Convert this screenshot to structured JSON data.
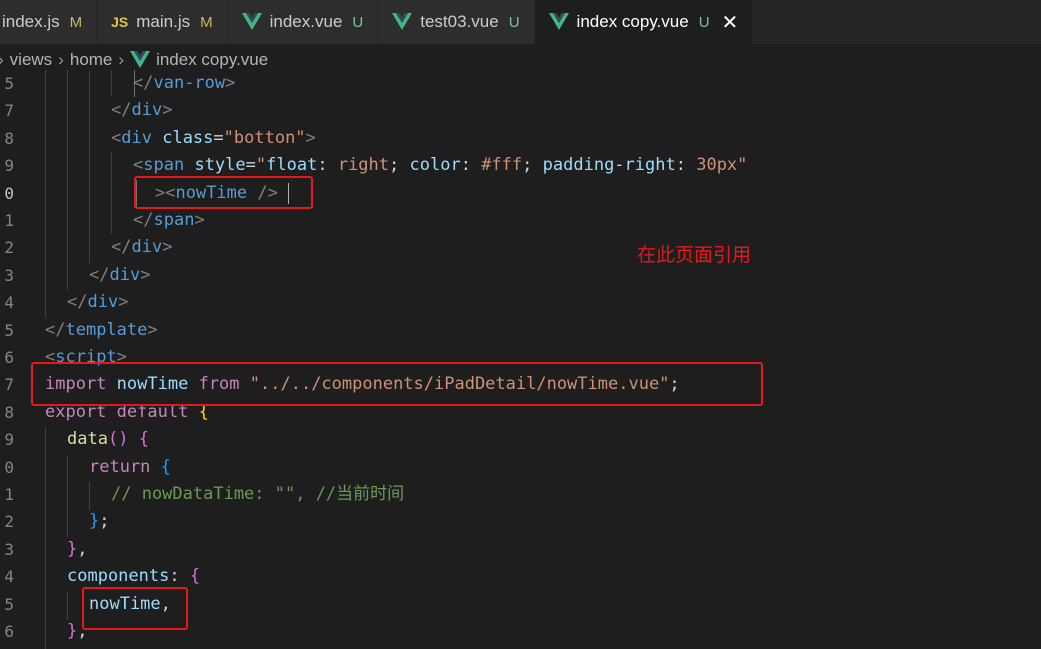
{
  "tabs": [
    {
      "label": "index.js",
      "status": "M",
      "icon": "js"
    },
    {
      "label": "main.js",
      "status": "M",
      "icon": "js",
      "icon_text": "JS"
    },
    {
      "label": "index.vue",
      "status": "U",
      "icon": "vue"
    },
    {
      "label": "test03.vue",
      "status": "U",
      "icon": "vue"
    },
    {
      "label": "index copy.vue",
      "status": "U",
      "icon": "vue",
      "active": true,
      "close": "✕"
    }
  ],
  "breadcrumb": {
    "items": [
      "views",
      "home",
      "index copy.vue"
    ],
    "separator": "›"
  },
  "lines": [
    {
      "num": "5"
    },
    {
      "num": "7"
    },
    {
      "num": "8"
    },
    {
      "num": "9"
    },
    {
      "num": "0"
    },
    {
      "num": "1"
    },
    {
      "num": "2"
    },
    {
      "num": "3"
    },
    {
      "num": "4"
    },
    {
      "num": "5"
    },
    {
      "num": "6"
    },
    {
      "num": "7"
    },
    {
      "num": "8"
    },
    {
      "num": "9"
    },
    {
      "num": "0"
    },
    {
      "num": "1"
    },
    {
      "num": "2"
    },
    {
      "num": "3"
    },
    {
      "num": "4"
    },
    {
      "num": "5"
    },
    {
      "num": "6"
    }
  ],
  "code": {
    "l1": {
      "c": "</",
      "tag": "van-row",
      "e": ">"
    },
    "l2": {
      "c": "</",
      "tag": "div",
      "e": ">"
    },
    "l3": {
      "o": "<",
      "tag": "div",
      "attr": "class",
      "eq": "=",
      "val": "\"botton\"",
      "e": ">"
    },
    "l4": {
      "o": "<",
      "tag": "span",
      "attr": "style",
      "eq": "=",
      "val_q": "\"",
      "css1": "float",
      "css1v": "right",
      "css2": "color",
      "css2v": "#fff",
      "css3": "padding-right",
      "css3v": "30px",
      "val_e": "\"",
      "colon": ":",
      "semi": ";"
    },
    "l5": {
      "o": "><",
      "tag": "nowTime",
      "e": " />"
    },
    "l6": {
      "c": "</",
      "tag": "span",
      "e": ">"
    },
    "l7": {
      "c": "</",
      "tag": "div",
      "e": ">"
    },
    "l8": {
      "c": "</",
      "tag": "div",
      "e": ">"
    },
    "l9": {
      "c": "</",
      "tag": "div",
      "e": ">"
    },
    "l10": {
      "c": "</",
      "tag": "template",
      "e": ">"
    },
    "l11": {
      "o": "<",
      "tag": "script",
      "e": ">"
    },
    "l12": {
      "kw1": "import",
      "name": "nowTime",
      "kw2": "from",
      "path": "\"../../components/iPadDetail/nowTime.vue\"",
      "semi": ";"
    },
    "l13": {
      "kw1": "export",
      "kw2": "default",
      "brace": "{"
    },
    "l14": {
      "fn": "data",
      "paren": "()",
      "brace": "{"
    },
    "l15": {
      "kw": "return",
      "brace": "{"
    },
    "l16": {
      "comment": "// nowDataTime: \"\", //当前时间"
    },
    "l17": {
      "brace": "}",
      "semi": ";"
    },
    "l18": {
      "brace": "}",
      "comma": ","
    },
    "l19": {
      "key": "components",
      "colon": ":",
      "brace": "{"
    },
    "l20": {
      "name": "nowTime",
      "comma": ","
    },
    "l21": {
      "brace": "}",
      "comma": ","
    }
  },
  "annotation": {
    "text": "在此页面引用",
    "color": "#e5191d"
  },
  "colors": {
    "editor_bg": "#1e1e1e",
    "tabbar_bg": "#252526",
    "highlight": "#e5191d",
    "vue_green": "#41b883"
  }
}
